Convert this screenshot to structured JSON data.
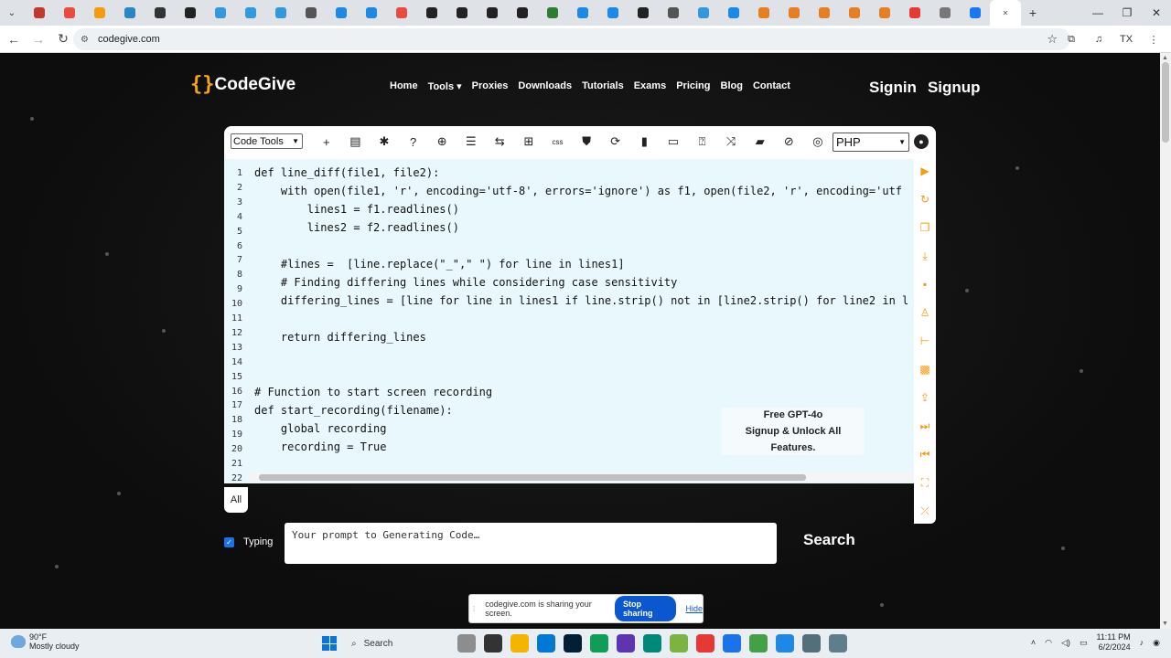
{
  "browser": {
    "url": "codegive.com",
    "tab_colors": [
      "#c0392b",
      "#e74c3c",
      "#f39c12",
      "#2e86c1",
      "#333333",
      "#222222",
      "#3498db",
      "#3498db",
      "#3498db",
      "#555555",
      "#1e88e5",
      "#1e88e5",
      "#e74c3c",
      "#222222",
      "#222222",
      "#222222",
      "#222222",
      "#2e7d32",
      "#1e88e5",
      "#1e88e5",
      "#222222",
      "#555555",
      "#3498db",
      "#1e88e5",
      "#e67e22",
      "#e67e22",
      "#e67e22",
      "#e67e22",
      "#e67e22",
      "#e53935",
      "#777777",
      "#1877f2"
    ],
    "window_controls": [
      "—",
      "❐",
      "✕"
    ]
  },
  "site": {
    "logo_text": "CodeGive",
    "nav": [
      "Home",
      "Tools ▾",
      "Proxies",
      "Downloads",
      "Tutorials",
      "Exams",
      "Pricing",
      "Blog",
      "Contact"
    ],
    "signin": "Signin",
    "signup": "Signup"
  },
  "editor": {
    "tools_select": "Code Tools",
    "language_select": "PHP",
    "tool_icons": [
      "plus-icon",
      "document-icon",
      "bug-icon",
      "help-icon",
      "globe-icon",
      "list-icon",
      "sliders-icon",
      "grid-icon",
      "css-icon",
      "shield-icon",
      "refresh-globe-icon",
      "book-icon",
      "terminal-icon",
      "question-box-icon",
      "shuffle-icon",
      "comment-icon",
      "video-off-icon",
      "toggle-icon"
    ],
    "tool_glyphs": [
      "+",
      "▤",
      "✱",
      "?",
      "⊕",
      "☰",
      "⇆",
      "⊞",
      "css",
      "⛊",
      "⟳",
      "▮",
      "▭",
      "⍰",
      "⤨",
      "▰",
      "⊘",
      "◎"
    ],
    "line_numbers": [
      "1",
      "2",
      "3",
      "4",
      "5",
      "6",
      "7",
      "8",
      "9",
      "10",
      "11",
      "12",
      "13",
      "14",
      "15",
      "16",
      "17",
      "18",
      "19",
      "20",
      "21",
      "22"
    ],
    "code_lines": [
      "def line_diff(file1, file2):",
      "    with open(file1, 'r', encoding='utf-8', errors='ignore') as f1, open(file2, 'r', encoding='utf",
      "        lines1 = f1.readlines()",
      "        lines2 = f2.readlines()",
      "",
      "    #lines =  [line.replace(\"_\",\" \") for line in lines1]",
      "    # Finding differing lines while considering case sensitivity",
      "    differing_lines = [line for line in lines1 if line.strip() not in [line2.strip() for line2 in l",
      "",
      "    return differing_lines",
      "",
      "",
      "# Function to start screen recording",
      "def start_recording(filename):",
      "    global recording",
      "    recording = True",
      ""
    ],
    "promo_line1": "Free GPT-4o",
    "promo_line2": "Signup & Unlock All",
    "promo_line3": "Features.",
    "sidebar_icons": [
      "play-icon",
      "refresh-icon",
      "copy-icon",
      "download-icon",
      "save-icon",
      "clean-icon",
      "split-icon",
      "image-icon",
      "upload-file-icon",
      "skip-end-icon",
      "skip-start-icon",
      "fullscreen-icon",
      "share-icon"
    ],
    "sidebar_glyphs": [
      "▶",
      "↻",
      "❐",
      "⤓",
      "▪",
      "♙",
      "⊢",
      "▩",
      "⇪",
      "⏭",
      "⏮",
      "⛶",
      "⤫"
    ],
    "all_button": "All"
  },
  "prompt": {
    "typing_label": "Typing",
    "typing_checked": true,
    "placeholder": "Your prompt to Generating Code…",
    "search_label": "Search"
  },
  "share_bar": {
    "message": "codegive.com is sharing your screen.",
    "stop_label": "Stop sharing",
    "hide_label": "Hide"
  },
  "taskbar": {
    "temperature": "90°F",
    "weather": "Mostly cloudy",
    "search_label": "Search",
    "time": "11:11 PM",
    "date": "6/2/2024",
    "app_colors": [
      "#8d8d8d",
      "#333333",
      "#f4b400",
      "#0078d4",
      "#001e36",
      "#0f9d58",
      "#5e35b1",
      "#00897b",
      "#7cb342",
      "#e53935",
      "#1a73e8",
      "#43a047",
      "#1e88e5",
      "#546e7a",
      "#607d8b"
    ]
  }
}
